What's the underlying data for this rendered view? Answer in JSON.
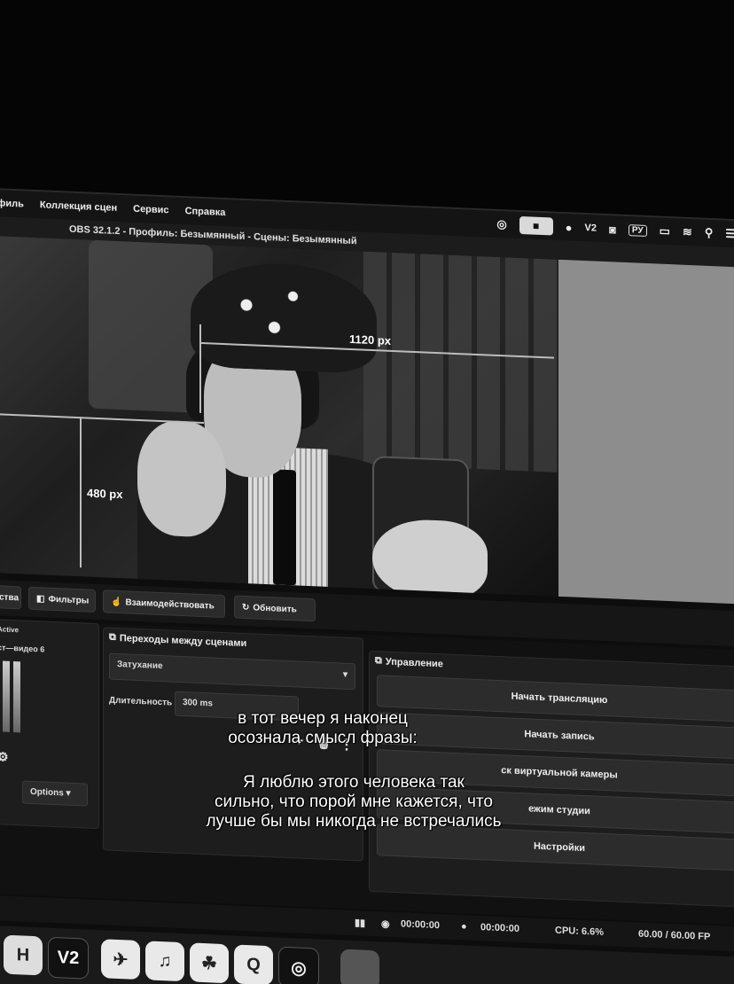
{
  "menubar": {
    "items": [
      "офиль",
      "Коллекция сцен",
      "Сервис",
      "Справка"
    ],
    "status_icons": [
      "obs-icon",
      "camera-icon",
      "profile-icon",
      "v2-icon",
      "app-icon",
      "keyboard-layout-icon",
      "battery-icon",
      "wifi-icon",
      "search-icon",
      "control-center-icon"
    ],
    "v2": "V2",
    "keyboard": "РУ"
  },
  "window": {
    "title": "OBS 32.1.2 - Профиль: Безымянный - Сцены: Безымянный"
  },
  "preview": {
    "width_label": "1120 px",
    "height_label": "480 px"
  },
  "toolbar": {
    "properties": "ства",
    "filters": "Фильтры",
    "interact": "Взаимодействовать",
    "refresh": "Обновить"
  },
  "mixer": {
    "active": "Active",
    "source": "ст—видео 6",
    "options": "Options"
  },
  "transitions": {
    "title": "Переходы между сценами",
    "type": "Затухание",
    "duration_label": "Длительность",
    "duration_value": "300 ms"
  },
  "controls": {
    "title": "Управление",
    "start_stream": "Начать трансляцию",
    "start_record": "Начать запись",
    "virtual_cam": "ск виртуальной камеры",
    "studio_mode": "ежим студии",
    "settings": "Настройки"
  },
  "statusbar": {
    "stream_time": "00:00:00",
    "record_time": "00:00:00",
    "cpu": "CPU: 6.6%",
    "fps": "60.00 / 60.00 FP"
  },
  "dock": {
    "v2": "V2"
  },
  "caption": {
    "line1": "в тот вечер я наконец",
    "line2": "осознала смысл фразы:",
    "line3": "Я люблю этого человека так",
    "line4": "сильно, что порой мне кажется, что",
    "line5": "лучше бы мы никогда не встречались"
  }
}
